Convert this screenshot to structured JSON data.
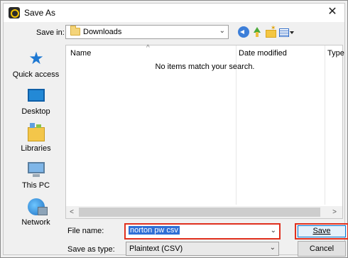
{
  "window": {
    "title": "Save As",
    "close_glyph": "✕",
    "app_icon": "app-logo-icon"
  },
  "toolbar": {
    "save_in_label": "Save in:",
    "save_in_value": "Downloads",
    "icons": [
      "back-icon",
      "up-folder-icon",
      "new-folder-icon",
      "view-menu-icon"
    ]
  },
  "places": [
    {
      "label": "Quick access",
      "icon": "star-icon"
    },
    {
      "label": "Desktop",
      "icon": "desktop-icon"
    },
    {
      "label": "Libraries",
      "icon": "libraries-icon"
    },
    {
      "label": "This PC",
      "icon": "computer-icon"
    },
    {
      "label": "Network",
      "icon": "network-icon"
    }
  ],
  "filelist": {
    "columns": [
      "Name",
      "Date modified",
      "Type"
    ],
    "empty_message": "No items match your search."
  },
  "form": {
    "file_name_label": "File name:",
    "file_name_value": "norton pw csv",
    "save_as_type_label": "Save as type:",
    "save_as_type_value": "Plaintext (CSV)"
  },
  "buttons": {
    "save": "Save",
    "cancel": "Cancel"
  },
  "colors": {
    "highlight_border": "#e0301e",
    "selection": "#2f6fd6"
  }
}
